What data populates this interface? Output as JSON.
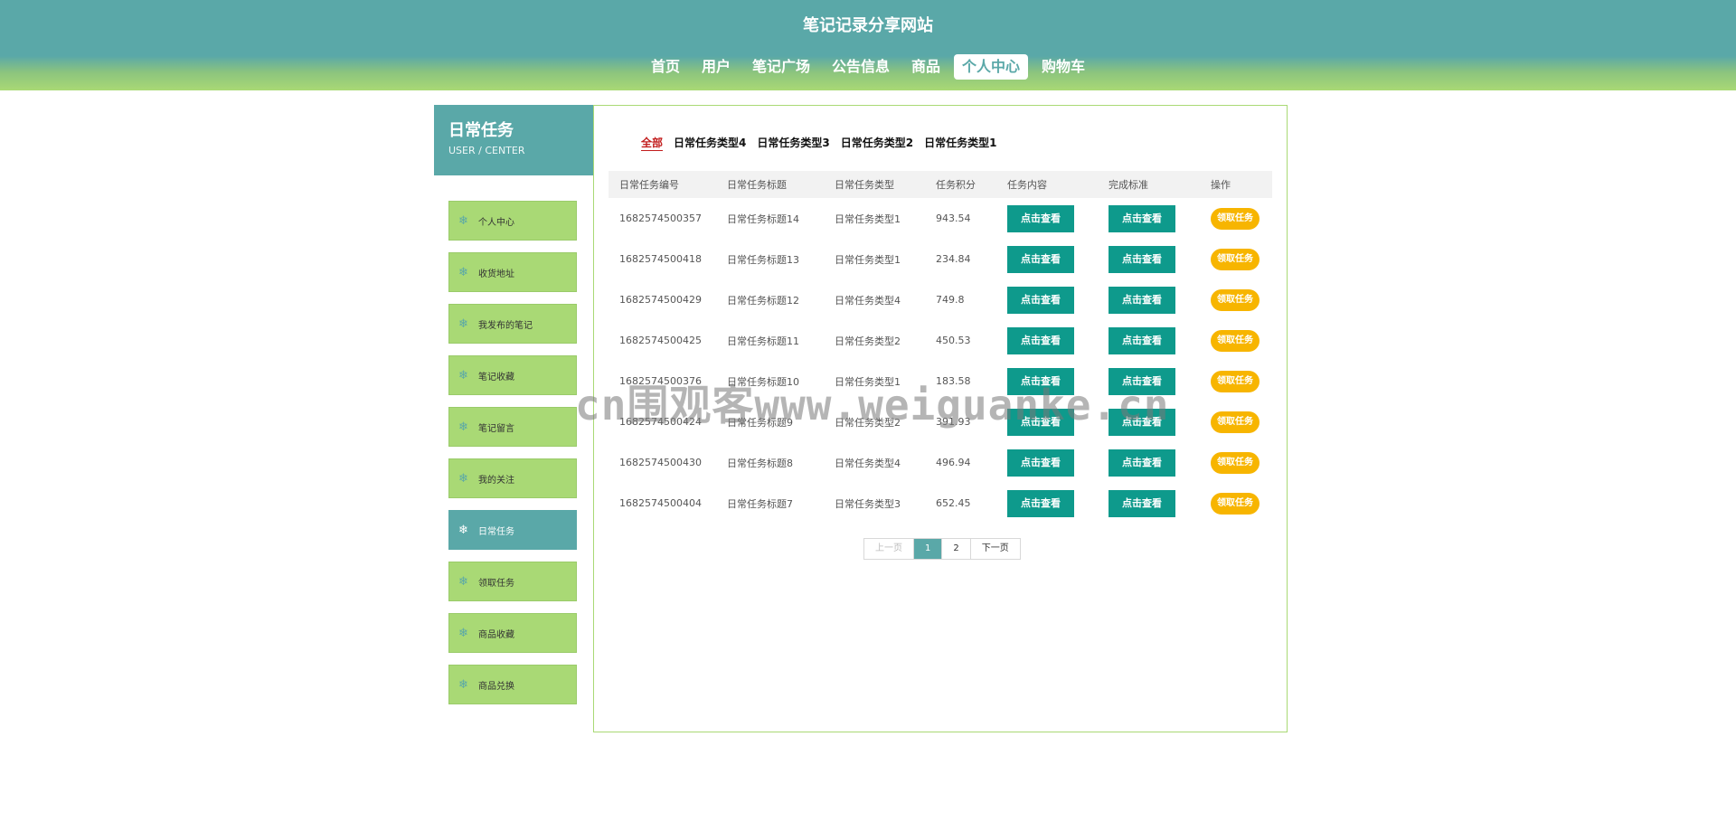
{
  "site": {
    "title": "笔记记录分享网站",
    "nav": [
      {
        "label": "首页"
      },
      {
        "label": "用户"
      },
      {
        "label": "笔记广场"
      },
      {
        "label": "公告信息"
      },
      {
        "label": "商品"
      },
      {
        "label": "个人中心",
        "active": true
      },
      {
        "label": "购物车"
      }
    ]
  },
  "sidebar": {
    "title": "日常任务",
    "subtitle": "USER / CENTER",
    "items": [
      {
        "label": "个人中心",
        "icon": "snowflake-icon"
      },
      {
        "label": "收货地址",
        "icon": "snowflake-icon"
      },
      {
        "label": "我发布的笔记",
        "icon": "snowflake-icon"
      },
      {
        "label": "笔记收藏",
        "icon": "snowflake-icon"
      },
      {
        "label": "笔记留言",
        "icon": "snowflake-icon"
      },
      {
        "label": "我的关注",
        "icon": "snowflake-icon"
      },
      {
        "label": "日常任务",
        "icon": "snowflake-icon",
        "active": true
      },
      {
        "label": "领取任务",
        "icon": "snowflake-icon"
      },
      {
        "label": "商品收藏",
        "icon": "snowflake-icon"
      },
      {
        "label": "商品兑换",
        "icon": "snowflake-icon"
      }
    ]
  },
  "filters": [
    {
      "label": "全部",
      "active": true
    },
    {
      "label": "日常任务类型4"
    },
    {
      "label": "日常任务类型3"
    },
    {
      "label": "日常任务类型2"
    },
    {
      "label": "日常任务类型1"
    }
  ],
  "table": {
    "headers": [
      "日常任务编号",
      "日常任务标题",
      "日常任务类型",
      "任务积分",
      "任务内容",
      "完成标准",
      "操作"
    ],
    "view_label": "点击查看",
    "action_label": "领取任务",
    "rows": [
      {
        "id": "1682574500357",
        "title": "日常任务标题14",
        "type": "日常任务类型1",
        "points": "943.54"
      },
      {
        "id": "1682574500418",
        "title": "日常任务标题13",
        "type": "日常任务类型1",
        "points": "234.84"
      },
      {
        "id": "1682574500429",
        "title": "日常任务标题12",
        "type": "日常任务类型4",
        "points": "749.8"
      },
      {
        "id": "1682574500425",
        "title": "日常任务标题11",
        "type": "日常任务类型2",
        "points": "450.53"
      },
      {
        "id": "1682574500376",
        "title": "日常任务标题10",
        "type": "日常任务类型1",
        "points": "183.58"
      },
      {
        "id": "1682574500424",
        "title": "日常任务标题9",
        "type": "日常任务类型2",
        "points": "391.93"
      },
      {
        "id": "1682574500430",
        "title": "日常任务标题8",
        "type": "日常任务类型4",
        "points": "496.94"
      },
      {
        "id": "1682574500404",
        "title": "日常任务标题7",
        "type": "日常任务类型3",
        "points": "652.45"
      }
    ]
  },
  "pagination": {
    "prev": "上一页",
    "pages": [
      "1",
      "2"
    ],
    "current": "1",
    "next": "下一页"
  },
  "watermark": "cn围观客www.weiguanke.cn",
  "colors": {
    "primary": "#5aa8a8",
    "accent_green": "#a9d975",
    "button_teal": "#0e9a8c",
    "action_yellow": "#f7b500",
    "filter_active": "#c21d1d"
  }
}
